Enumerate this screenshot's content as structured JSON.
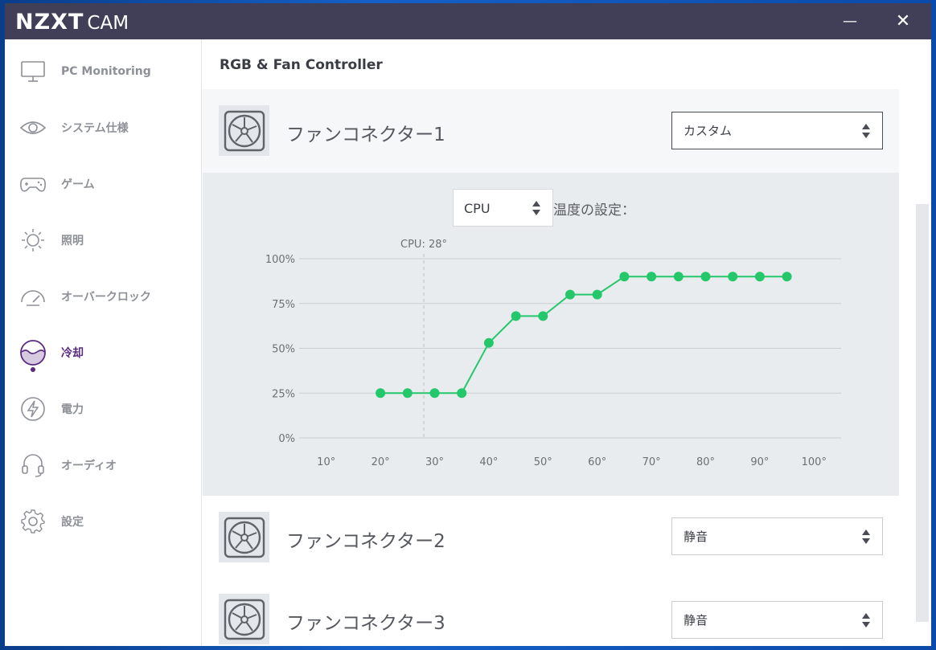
{
  "titlebar": {
    "logo_bold": "NZXT",
    "logo_light": "CAM",
    "minimize": "—",
    "close": "✕"
  },
  "sidebar": {
    "items": [
      {
        "label": "PC Monitoring",
        "icon": "monitor-icon"
      },
      {
        "label": "システム仕様",
        "icon": "eye-icon"
      },
      {
        "label": "ゲーム",
        "icon": "gamepad-icon"
      },
      {
        "label": "照明",
        "icon": "sun-icon"
      },
      {
        "label": "オーバークロック",
        "icon": "speedometer-icon"
      },
      {
        "label": "冷却",
        "icon": "cooling-icon",
        "active": true
      },
      {
        "label": "電力",
        "icon": "lightning-icon"
      },
      {
        "label": "オーディオ",
        "icon": "headset-icon"
      },
      {
        "label": "設定",
        "icon": "gear-icon"
      }
    ]
  },
  "main": {
    "title": "RGB & Fan Controller",
    "fans": [
      {
        "name": "ファンコネクター1",
        "mode": "カスタム"
      },
      {
        "name": "ファンコネクター2",
        "mode": "静音"
      },
      {
        "name": "ファンコネクター3",
        "mode": "静音"
      }
    ],
    "sensor": "CPU",
    "temp_label": "温度の設定："
  },
  "colors": {
    "accent": "#24c86a",
    "active_nav": "#5a2a82",
    "titlebar": "#413e57"
  },
  "chart_data": {
    "type": "line",
    "x": [
      20,
      25,
      30,
      35,
      40,
      45,
      50,
      55,
      60,
      65,
      70,
      75,
      80,
      85,
      90,
      95
    ],
    "y": [
      25,
      25,
      25,
      25,
      53,
      68,
      68,
      80,
      80,
      90,
      90,
      90,
      90,
      90,
      90,
      90
    ],
    "xlim": [
      5,
      105
    ],
    "ylim": [
      0,
      100
    ],
    "x_ticks": [
      "10°",
      "20°",
      "30°",
      "40°",
      "50°",
      "60°",
      "70°",
      "80°",
      "90°",
      "100°"
    ],
    "x_tick_values": [
      10,
      20,
      30,
      40,
      50,
      60,
      70,
      80,
      90,
      100
    ],
    "y_ticks": [
      "0%",
      "25%",
      "50%",
      "75%",
      "100%"
    ],
    "y_tick_values": [
      0,
      25,
      50,
      75,
      100
    ],
    "marker": {
      "label": "CPU: 28°",
      "x": 28
    },
    "grid": true
  }
}
